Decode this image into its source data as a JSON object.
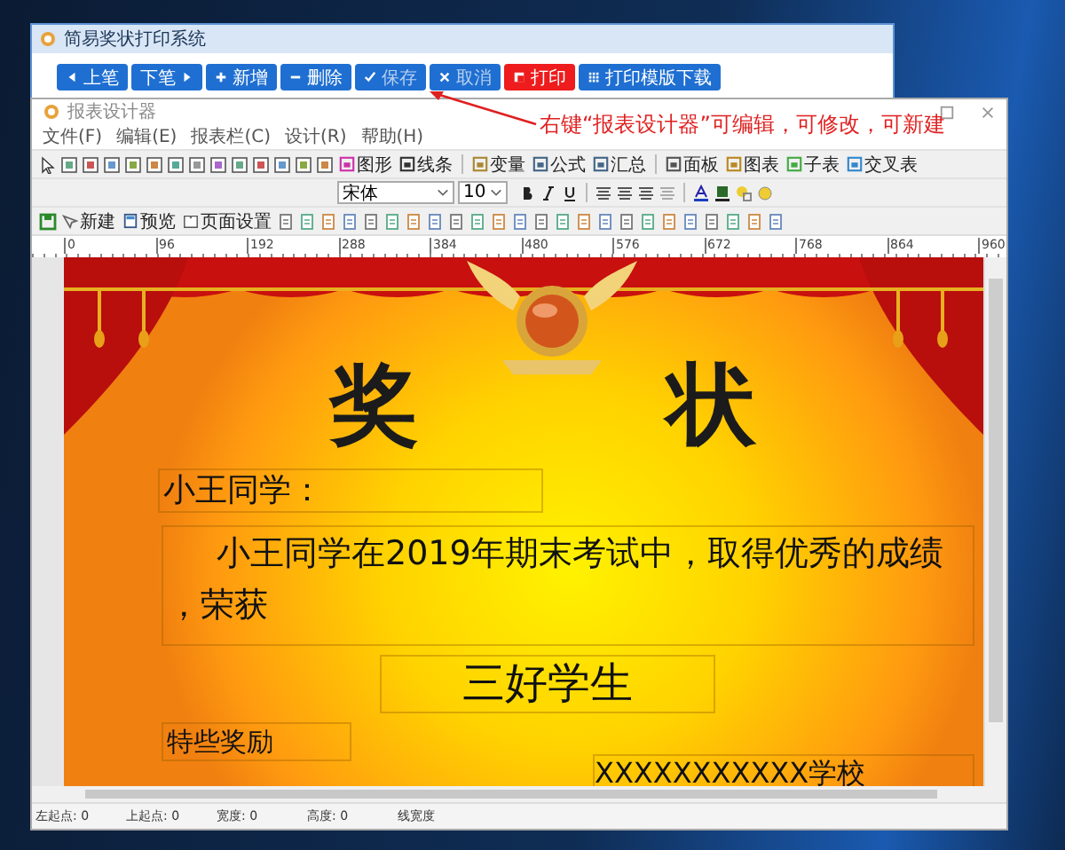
{
  "desktop_window": {
    "title": "简易奖状打印系统",
    "buttons": [
      {
        "label": "上笔",
        "highlighted": false,
        "disabled": false
      },
      {
        "label": "下笔",
        "highlighted": false,
        "disabled": false
      },
      {
        "label": "新增",
        "highlighted": false,
        "disabled": false
      },
      {
        "label": "删除",
        "highlighted": false,
        "disabled": false
      },
      {
        "label": "保存",
        "highlighted": false,
        "disabled": true
      },
      {
        "label": "取消",
        "highlighted": false,
        "disabled": true
      },
      {
        "label": "打印",
        "highlighted": true,
        "disabled": false
      },
      {
        "label": "打印模版下载",
        "highlighted": false,
        "disabled": false
      }
    ]
  },
  "annotation": "右键“报表设计器”可编辑，可修改，可新建",
  "designer": {
    "title": "报表设计器",
    "menu": [
      "文件(F)",
      "编辑(E)",
      "报表栏(C)",
      "设计(R)",
      "帮助(H)"
    ],
    "toolbar_objects": [
      "图形",
      "线条",
      "变量",
      "公式",
      "汇总",
      "面板",
      "图表",
      "子表",
      "交叉表"
    ],
    "font": {
      "name": "宋体",
      "size": "10"
    },
    "toolbar_file": [
      "新建",
      "预览",
      "页面设置"
    ],
    "ruler": [
      "0",
      "96",
      "192",
      "288",
      "384",
      "480",
      "576",
      "672",
      "768",
      "864",
      "960"
    ],
    "certificate": {
      "title_chars": [
        "奖",
        "状"
      ],
      "salutation": "小王同学：",
      "body": "小王同学在2019年期末考试中，取得优秀的成绩，荣获",
      "award": "三好学生",
      "note": "特些奖励",
      "school": "XXXXXXXXXXX学校"
    },
    "status_bar": [
      "左起点: 0",
      "上起点: 0",
      "宽度: 0",
      "高度: 0",
      "线宽度"
    ]
  }
}
